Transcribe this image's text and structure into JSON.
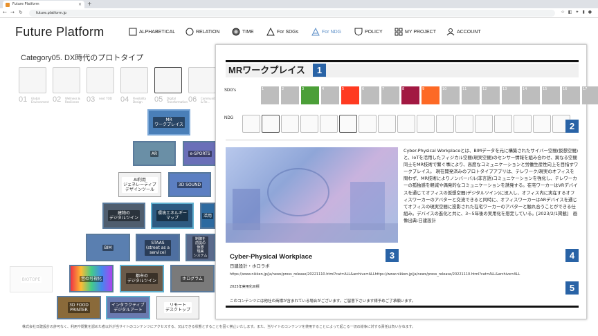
{
  "browser": {
    "tab_title": "Future Platform",
    "new_tab": "+",
    "close": "×",
    "back": "←",
    "forward": "→",
    "reload": "↻",
    "url": "future.platform.jp"
  },
  "logo": "Future Platform",
  "menu": [
    {
      "label": "ALPHABETICAL",
      "icon": "square-icon"
    },
    {
      "label": "RELATION",
      "icon": "circle-icon"
    },
    {
      "label": "TIME",
      "icon": "clock-icon"
    },
    {
      "label": "For SDGs",
      "icon": "triangle-icon"
    },
    {
      "label": "For NDG",
      "icon": "triangle-blue-icon",
      "active": true
    },
    {
      "label": "POLICY",
      "icon": "shield-icon"
    },
    {
      "label": "MY PROJECT",
      "icon": "grid-icon"
    },
    {
      "label": "ACCOUNT",
      "icon": "person-icon"
    }
  ],
  "category_title": "Category05. DX時代のプロトタイプ",
  "categories": [
    {
      "num": "01",
      "label": "Global Environment"
    },
    {
      "num": "02",
      "label": "Wellness & Resilience"
    },
    {
      "num": "03",
      "label": "next TOD"
    },
    {
      "num": "04",
      "label": "Flexibility Design"
    },
    {
      "num": "05",
      "label": "Digital Transformation"
    },
    {
      "num": "06",
      "label": "Community & Re..."
    }
  ],
  "nodes": [
    {
      "label": "MR\nワークプレイス"
    },
    {
      "label": "AR"
    },
    {
      "label": "e-SPORTS"
    },
    {
      "label": "AI利用\nジェネレーティブ\nデザインツール"
    },
    {
      "label": "3D SOUND"
    },
    {
      "label": "建物の\nデジタルツイン"
    },
    {
      "label": "環境エネルギー\nマップ"
    },
    {
      "label": "活用"
    },
    {
      "label": "BIM"
    },
    {
      "label": "STAAS\n(street as a\nservice)"
    },
    {
      "label": "制御を\n前提の\n仮想\n現実\nシステム"
    },
    {
      "label": "BIOTOPE"
    },
    {
      "label": "音の可視化"
    },
    {
      "label": "都市の\nデジタルツイン"
    },
    {
      "label": "ホログラム"
    },
    {
      "label": "3D FOOD\nPRINTER"
    },
    {
      "label": "インタラクティブ\nデジタルアート"
    },
    {
      "label": "リモート\nデスクトップ"
    }
  ],
  "footer": "株式会社日建設計の許可なく、利用や閲覧を認めた者以外が当サイトのコンテンツにアクセスする、又はできる状態とすることを固く禁止いたします。また、当サイトのコンテンツを使用することによって起こる一切の紛争に対する責任は負いかねます。",
  "panel": {
    "title": "MRワークプレイス",
    "sdgs_label": "SDG's",
    "ndg_label": "NDG",
    "badges": [
      "1",
      "2",
      "3",
      "4",
      "5"
    ],
    "sdgs": [
      {
        "n": "1",
        "color": "#bdbdbd"
      },
      {
        "n": "2",
        "color": "#bdbdbd"
      },
      {
        "n": "3",
        "color": "#4c9f38"
      },
      {
        "n": "4",
        "color": "#bdbdbd"
      },
      {
        "n": "5",
        "color": "#ff3a21"
      },
      {
        "n": "6",
        "color": "#bdbdbd"
      },
      {
        "n": "7",
        "color": "#bdbdbd"
      },
      {
        "n": "8",
        "color": "#a21942"
      },
      {
        "n": "9",
        "color": "#fd6925"
      },
      {
        "n": "10",
        "color": "#bdbdbd"
      },
      {
        "n": "11",
        "color": "#bdbdbd"
      },
      {
        "n": "12",
        "color": "#bdbdbd"
      },
      {
        "n": "13",
        "color": "#bdbdbd"
      },
      {
        "n": "14",
        "color": "#bdbdbd"
      },
      {
        "n": "15",
        "color": "#bdbdbd"
      },
      {
        "n": "16",
        "color": "#bdbdbd"
      },
      {
        "n": "17",
        "color": "#bdbdbd"
      },
      {
        "n": "",
        "color": "#bdbdbd"
      }
    ],
    "ndg_count": 17,
    "description": "Cyber-Physical Workplaceとは、BIMデータを元に構築されたサイバー空間(仮想空間)と、IoTを活用したフィジカル空間(現実空間)のセンサー情報を組み合わせ、異なる空間同士をMR技術で繋ぐ事により、高度なコミュニケーションと労働生産性向上を目指すワークプレイス。 現在開発済みのプロトタイプアプリは、テレワーク/現実のオフィスを問わず、MR技術によりノンバーバル(非言語)コミュニケーションを強化し、テレワーカーの孤独感を軽減や偶発的なコミュニケーションを誘発する。在宅ワーカーはVRデバイスを通じてオフィスの仮想空間(デジタルツイン)に没入し、オフィス内に実在するオフィスワーカーのアバターと交流できると同時に、オフィスワーカーはARデバイスを通じてオフィスの現実空間に投影された在宅ワーカーのアバターと触れ合うことができる仕組み。デバイスの進化と共に、3~5年後の実用化を想定している。[2023/2/1掲載]　画像出典:日建設計",
    "content_title": "Cyber-Physical Workplace",
    "content_sub": "日建設計・ホロラボ",
    "links": "https://www.nikken.jp/ja/news/press_release/20221110.html?cat=ALL&archive=ALLhttps://www.nikken.jp/ja/news/press_release/20221110.html?cat=ALL&archive=ALL",
    "year": "2025年実用化目標",
    "note": "このコンテンツには他社の商標が含まれている場合がございます。ご留意下さいます様予めご了承願います。"
  }
}
